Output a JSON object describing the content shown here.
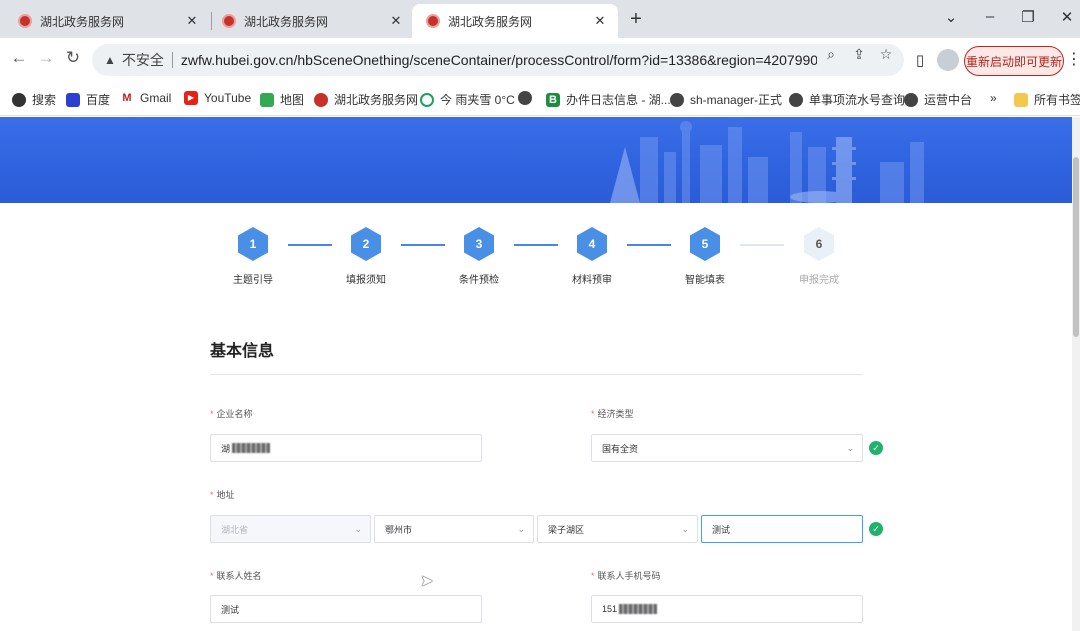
{
  "tabs": [
    {
      "title": "湖北政务服务网",
      "close": "✕"
    },
    {
      "title": "湖北政务服务网",
      "close": "✕"
    },
    {
      "title": "湖北政务服务网",
      "close": "✕"
    }
  ],
  "new_tab": "+",
  "window_controls": {
    "dropdown": "⌄",
    "minimize": "–",
    "restore": "❐",
    "close": "✕"
  },
  "toolbar": {
    "back": "←",
    "forward": "→",
    "reload": "↻",
    "security_label": "不安全",
    "url": "zwfw.hubei.gov.cn/hbSceneOnething/sceneContainer/processControl/form?id=13386&region=420799000000...",
    "update_button": "重新启动即可更新",
    "menu": "⋮"
  },
  "bookmarks": [
    {
      "label": "搜索",
      "icon": "search-pin-icon"
    },
    {
      "label": "百度",
      "icon": "baidu-icon"
    },
    {
      "label": "Gmail",
      "icon": "gmail-icon"
    },
    {
      "label": "YouTube",
      "icon": "youtube-icon"
    },
    {
      "label": "地图",
      "icon": "maps-icon"
    },
    {
      "label": "湖北政务服务网",
      "icon": "hubei-gov-icon"
    },
    {
      "label": "今 雨夹雪 0°C",
      "icon": "weather-icon"
    },
    {
      "label": "",
      "icon": "globe-icon"
    },
    {
      "label": "办件日志信息 - 湖...",
      "icon": "b-icon"
    },
    {
      "label": "sh-manager-正式",
      "icon": "globe-icon"
    },
    {
      "label": "单事项流水号查询",
      "icon": "globe-icon"
    },
    {
      "label": "运营中台",
      "icon": "globe-icon"
    },
    {
      "label": "»",
      "icon": ""
    },
    {
      "label": "所有书签",
      "icon": "folder-icon"
    }
  ],
  "steps": [
    {
      "num": "1",
      "label": "主题引导",
      "done": true
    },
    {
      "num": "2",
      "label": "填报须知",
      "done": true
    },
    {
      "num": "3",
      "label": "条件预检",
      "done": true
    },
    {
      "num": "4",
      "label": "材料预审",
      "done": true
    },
    {
      "num": "5",
      "label": "智能填表",
      "done": true
    },
    {
      "num": "6",
      "label": "申报完成",
      "done": false
    }
  ],
  "form": {
    "section_title": "基本信息",
    "required_mark": "*",
    "company_label": "企业名称",
    "company_value": "湖",
    "economy_label": "经济类型",
    "economy_value": "国有全资",
    "address_label": "地址",
    "province": "湖北省",
    "city": "鄂州市",
    "district": "梁子湖区",
    "address_detail": "测试",
    "contact_name_label": "联系人姓名",
    "contact_name_value": "测试",
    "contact_phone_label": "联系人手机号码",
    "contact_phone_value": "151",
    "valid_mark": "✓"
  }
}
